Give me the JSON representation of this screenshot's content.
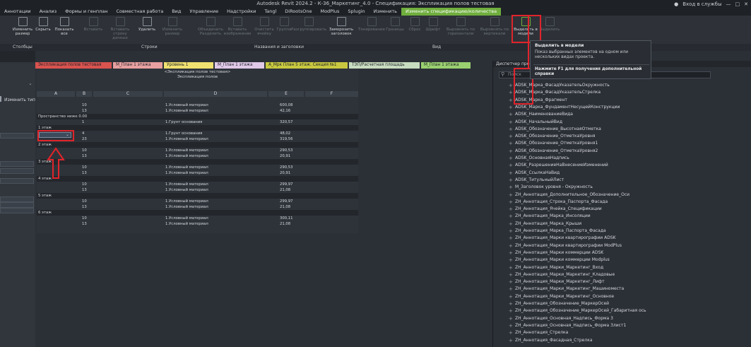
{
  "window": {
    "title": "Autodesk Revit 2024.2 - К-36_Маркетинг_4.0 - Спецификация: Экспликация полов тестовая",
    "user": "Вход в службы"
  },
  "menu": [
    "Аннотации",
    "Анализ",
    "Формы и генплан",
    "Совместная работа",
    "Вид",
    "Управление",
    "Надстройки",
    "Tangl",
    "DiRootsOne",
    "ModPlus",
    "Splugin",
    "Изменить",
    "Изменить спецификацию/количества"
  ],
  "ribbon": {
    "buttons": [
      {
        "label": "Изменить размер",
        "enabled": true
      },
      {
        "label": "Скрыть",
        "enabled": true
      },
      {
        "label": "Показать все",
        "enabled": true
      },
      {
        "label": "Вставить",
        "enabled": false
      },
      {
        "label": "Вставить строку данных",
        "enabled": false
      },
      {
        "label": "Удалить",
        "enabled": true
      },
      {
        "label": "Изменить размер",
        "enabled": false
      },
      {
        "label": "Объединить Разделить",
        "enabled": false
      },
      {
        "label": "Вставить изображение",
        "enabled": false
      },
      {
        "label": "Очистить ячейку",
        "enabled": false
      },
      {
        "label": "Группа",
        "enabled": false
      },
      {
        "label": "Разгруппировать",
        "enabled": false
      },
      {
        "label": "Заморозить заголовок",
        "enabled": true
      },
      {
        "label": "Тонирование",
        "enabled": false
      },
      {
        "label": "Границы",
        "enabled": false
      },
      {
        "label": "Сброс",
        "enabled": false
      },
      {
        "label": "Шрифт",
        "enabled": false
      },
      {
        "label": "Выровнять по горизонтали",
        "enabled": false
      },
      {
        "label": "Выровнять по вертикали",
        "enabled": false
      },
      {
        "label": "Выделить в модели",
        "enabled": true
      },
      {
        "label": "Выделить",
        "enabled": false
      }
    ],
    "panels": [
      "Столбцы",
      "Строки",
      "Названия и заголовки",
      "Вид"
    ]
  },
  "left_panel": {
    "type_button": "Изменить тип"
  },
  "tabs": [
    {
      "label": "Экспликация полов тестовая",
      "color": "#d9534f"
    },
    {
      "label": "М_План 1 этажа",
      "color": "#e8a0a0"
    },
    {
      "label": "Уровень 1",
      "color": "#f0e070"
    },
    {
      "label": "М_План 1 этажа",
      "color": "#e0c8e8"
    },
    {
      "label": "А_Мрк План 5 этаж. Секция №1",
      "color": "#c8c840"
    },
    {
      "label": "ТЭП/Расчетная площадь",
      "color": "#c8dcc0"
    },
    {
      "label": "М_План 1 этажа",
      "color": "#9ad070"
    }
  ],
  "schedule": {
    "title": "<Экспликация полов тестовая>",
    "subtitle": "Экспликация полов",
    "columns": [
      "A",
      "B",
      "C",
      "D",
      "E",
      "F"
    ],
    "rows": [
      {
        "a": "",
        "b": "10",
        "d": "1.Условный материал",
        "e": "600,08"
      },
      {
        "a": "",
        "b": "13",
        "d": "1.Условный материал",
        "e": "42,16"
      },
      {
        "a": "Пространство ниже 0.00",
        "b": "",
        "d": "",
        "e": ""
      },
      {
        "a": "",
        "b": "1",
        "d": "1.Грунт основания",
        "e": "320,57"
      },
      {
        "a": "1 этаж",
        "b": "",
        "d": "",
        "e": ""
      },
      {
        "a": "",
        "b": "4",
        "d": "1.Грунт основания",
        "e": "48,02"
      },
      {
        "a": "",
        "b": "23",
        "d": "1.Условный материал",
        "e": "319,56"
      },
      {
        "a": "2 этаж",
        "b": "",
        "d": "",
        "e": ""
      },
      {
        "a": "",
        "b": "10",
        "d": "1.Условный материал",
        "e": "290,53"
      },
      {
        "a": "",
        "b": "13",
        "d": "1.Условный материал",
        "e": "20,91"
      },
      {
        "a": "3 этаж",
        "b": "",
        "d": "",
        "e": ""
      },
      {
        "a": "",
        "b": "10",
        "d": "1.Условный материал",
        "e": "290,53"
      },
      {
        "a": "",
        "b": "13",
        "d": "1.Условный материал",
        "e": "20,91"
      },
      {
        "a": "4 этаж",
        "b": "",
        "d": "",
        "e": ""
      },
      {
        "a": "",
        "b": "10",
        "d": "1.Условный материал",
        "e": "299,97"
      },
      {
        "a": "",
        "b": "13",
        "d": "1.Условный материал",
        "e": "21,08"
      },
      {
        "a": "5 этаж",
        "b": "",
        "d": "",
        "e": ""
      },
      {
        "a": "",
        "b": "10",
        "d": "1.Условный материал",
        "e": "299,97"
      },
      {
        "a": "",
        "b": "13",
        "d": "1.Условный материал",
        "e": "21,08"
      },
      {
        "a": "6 этаж",
        "b": "",
        "d": "",
        "e": ""
      },
      {
        "a": "",
        "b": "10",
        "d": "1.Условный материал",
        "e": "300,11"
      },
      {
        "a": "",
        "b": "13",
        "d": "1.Условный материал",
        "e": "21,08"
      }
    ]
  },
  "browser": {
    "header": "Диспетчер проекта",
    "search_placeholder": "Поиск",
    "items": [
      "ADSK_Марка_ФасадУказательОкружность",
      "ADSK_Марка_ФасадУказательСтрелка",
      "ADSK_Марка_Фрагмент",
      "ADSK_Марка_ФундаментНесущейКонструкции",
      "ADSK_НаименованиеВида",
      "ADSK_НачальныйВид",
      "ADSK_Обозначение_ВысотнаяОтметка",
      "ADSK_Обозначение_ОтметкаУровня",
      "ADSK_Обозначение_ОтметкаУровня1",
      "ADSK_Обозначение_ОтметкаУровня2",
      "ADSK_ОсновнаяНадпись",
      "ADSK_РазрешениеНаВнесениеИзменений",
      "ADSK_СсылкаНаВид",
      "ADSK_ТитульныйЛист",
      "M_Заголовок уровня - Окружность",
      "ZH_Аннотация_Дополнительное_Обозначение_Оси",
      "ZH_Аннотация_Строка_Паспорта_Фасада",
      "ZH_Аннотация_Ячейка_Спецификации",
      "ZH_Аннотация_Марка_Инсоляции",
      "ZH_Аннотация_Марка_Крыши",
      "ZH_Аннотация_Марка_Паспорта_Фасада",
      "ZH_Аннотация_Марки квартирографии ADSK",
      "ZH_Аннотация_Марки квартирографии ModPlus",
      "ZH_Аннотация_Марки коммерции ADSK",
      "ZH_Аннотация_Марки коммерции Modplus",
      "ZH_Аннотация_Марки_Маркетинг_Вход",
      "ZH_Аннотация_Марки_Маркетинг_Кладовые",
      "ZH_Аннотация_Марки_Маркетинг_Лифт",
      "ZH_Аннотация_Марки_Маркетинг_Машиноместа",
      "ZH_Аннотация_Марки_Маркетинг_Основное",
      "ZH_Аннотация_Обозначение_МаркерОсей",
      "ZH_Аннотация_Обозначение_МаркерОсей_Габаритная ось",
      "ZH_Аннотация_Основная_Надпись_Форма 3",
      "ZH_Аннотация_Основная_Надпись_Форма 3лист1",
      "ZH_Аннотация_Стрелка",
      "ZH_Аннотация_Фасадная_Стрелка"
    ]
  },
  "tooltip": {
    "title": "Выделить в модели",
    "body": "Показ выбранных элементов на одном или нескольких видах проекта.",
    "help": "Нажмите F1 для получения дополнительной справки"
  },
  "colors": {
    "accent": "#6fae3d",
    "callout": "#e0242b"
  }
}
